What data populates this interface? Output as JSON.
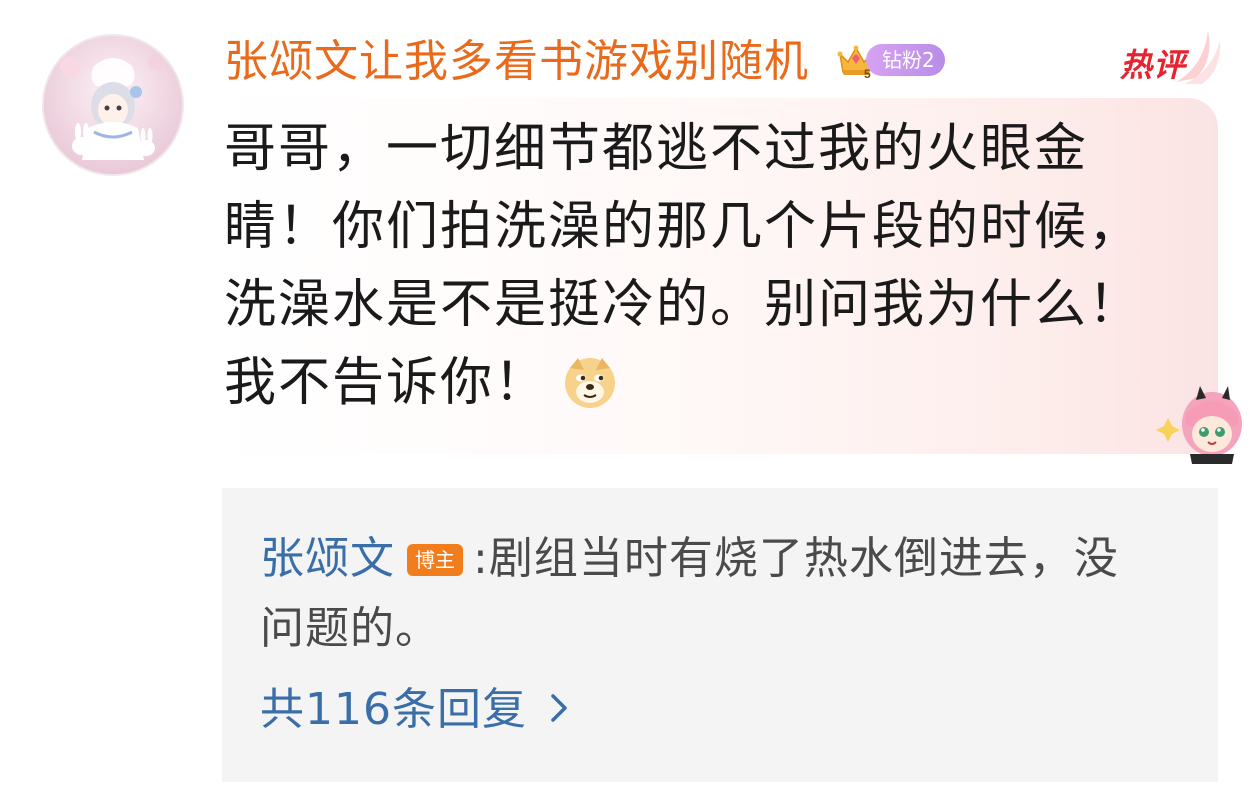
{
  "comment": {
    "username": "张颂文让我多看书游戏别随机",
    "fan_level_label": "钻粉2",
    "crown_level": "5",
    "hot_badge_label": "热评",
    "text": "哥哥，一切细节都逃不过我的火眼金睛！你们拍洗澡的那几个片段的时候，洗澡水是不是挺冷的。别问我为什么！我不告诉你！",
    "emoji": "doge-emoji"
  },
  "reply": {
    "author": "张颂文",
    "author_tag": "博主",
    "separator": ":",
    "text": "剧组当时有烧了热水倒进去，没问题的。",
    "count_label": "共116条回复"
  },
  "colors": {
    "username": "#ea6a1c",
    "reply_author": "#3a6ea8",
    "hot_badge": "#e8232f",
    "owner_tag": "#f27d1d",
    "fan_pill": "#c195ee",
    "reply_panel_bg": "#f4f4f4"
  },
  "icons": {
    "avatar": "anime-girl-avatar",
    "crown": "crown-icon",
    "hot": "hot-comment-badge",
    "emoji": "doge-emoji",
    "decoration": "anya-sticker",
    "expand": "chevron-right-icon"
  }
}
